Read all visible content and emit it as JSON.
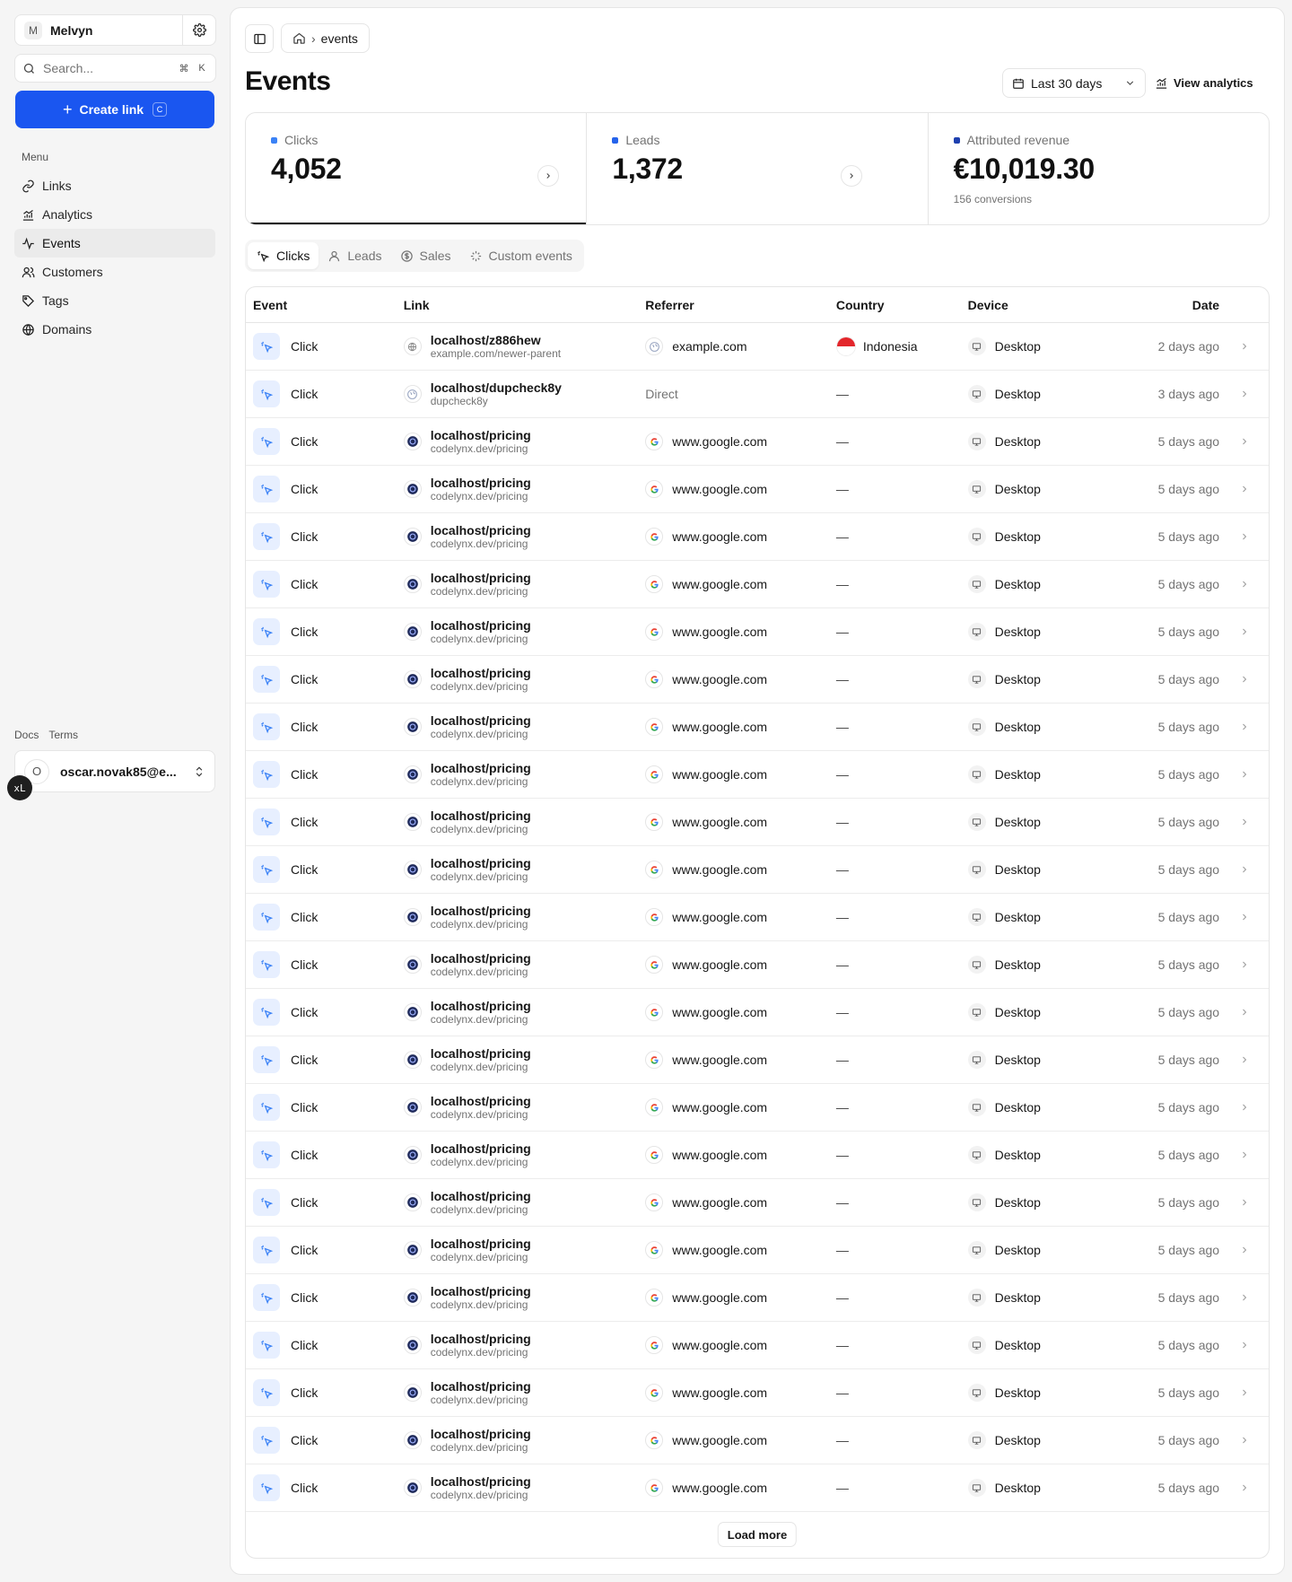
{
  "workspace": {
    "initial": "M",
    "name": "Melvyn"
  },
  "search": {
    "placeholder": "Search...",
    "shortcut_mod": "⌘",
    "shortcut_key": "K"
  },
  "create": {
    "label": "Create link",
    "shortcut": "C"
  },
  "menu": {
    "title": "Menu",
    "items": [
      {
        "label": "Links",
        "icon": "link-icon"
      },
      {
        "label": "Analytics",
        "icon": "chart-icon"
      },
      {
        "label": "Events",
        "icon": "activity-icon",
        "active": true
      },
      {
        "label": "Customers",
        "icon": "users-icon"
      },
      {
        "label": "Tags",
        "icon": "tag-icon"
      },
      {
        "label": "Domains",
        "icon": "globe-icon"
      }
    ]
  },
  "footer": {
    "docs": "Docs",
    "terms": "Terms"
  },
  "user": {
    "initial": "O",
    "email": "oscar.novak85@e...",
    "badge": "xL"
  },
  "breadcrumb": {
    "current": "events"
  },
  "page": {
    "title": "Events"
  },
  "date_range": {
    "label": "Last 30 days"
  },
  "view_analytics": {
    "label": "View analytics"
  },
  "stats": [
    {
      "label": "Clicks",
      "value": "4,052",
      "color": "#3b82f6"
    },
    {
      "label": "Leads",
      "value": "1,372",
      "color": "#2563eb"
    },
    {
      "label": "Attributed revenue",
      "value": "€10,019.30",
      "sub": "156 conversions",
      "color": "#1e40af"
    }
  ],
  "tabs": [
    {
      "label": "Clicks",
      "icon": "cursor-click-icon"
    },
    {
      "label": "Leads",
      "icon": "user-icon"
    },
    {
      "label": "Sales",
      "icon": "dollar-icon"
    },
    {
      "label": "Custom events",
      "icon": "sparkle-icon"
    }
  ],
  "table": {
    "headers": {
      "event": "Event",
      "link": "Link",
      "referrer": "Referrer",
      "country": "Country",
      "device": "Device",
      "date": "Date"
    },
    "rows": [
      {
        "event": "Click",
        "link": "localhost/z886hew",
        "dest": "example.com/newer-parent",
        "referrer": "example.com",
        "country": "Indonesia",
        "device": "Desktop",
        "date": "2 days ago"
      },
      {
        "event": "Click",
        "link": "localhost/dupcheck8y",
        "dest": "dupcheck8y",
        "referrer": "Direct",
        "country": "—",
        "device": "Desktop",
        "date": "3 days ago"
      },
      {
        "event": "Click",
        "link": "localhost/pricing",
        "dest": "codelynx.dev/pricing",
        "referrer": "www.google.com",
        "country": "—",
        "device": "Desktop",
        "date": "5 days ago"
      },
      {
        "event": "Click",
        "link": "localhost/pricing",
        "dest": "codelynx.dev/pricing",
        "referrer": "www.google.com",
        "country": "—",
        "device": "Desktop",
        "date": "5 days ago"
      },
      {
        "event": "Click",
        "link": "localhost/pricing",
        "dest": "codelynx.dev/pricing",
        "referrer": "www.google.com",
        "country": "—",
        "device": "Desktop",
        "date": "5 days ago"
      },
      {
        "event": "Click",
        "link": "localhost/pricing",
        "dest": "codelynx.dev/pricing",
        "referrer": "www.google.com",
        "country": "—",
        "device": "Desktop",
        "date": "5 days ago"
      },
      {
        "event": "Click",
        "link": "localhost/pricing",
        "dest": "codelynx.dev/pricing",
        "referrer": "www.google.com",
        "country": "—",
        "device": "Desktop",
        "date": "5 days ago"
      },
      {
        "event": "Click",
        "link": "localhost/pricing",
        "dest": "codelynx.dev/pricing",
        "referrer": "www.google.com",
        "country": "—",
        "device": "Desktop",
        "date": "5 days ago"
      },
      {
        "event": "Click",
        "link": "localhost/pricing",
        "dest": "codelynx.dev/pricing",
        "referrer": "www.google.com",
        "country": "—",
        "device": "Desktop",
        "date": "5 days ago"
      },
      {
        "event": "Click",
        "link": "localhost/pricing",
        "dest": "codelynx.dev/pricing",
        "referrer": "www.google.com",
        "country": "—",
        "device": "Desktop",
        "date": "5 days ago"
      },
      {
        "event": "Click",
        "link": "localhost/pricing",
        "dest": "codelynx.dev/pricing",
        "referrer": "www.google.com",
        "country": "—",
        "device": "Desktop",
        "date": "5 days ago"
      },
      {
        "event": "Click",
        "link": "localhost/pricing",
        "dest": "codelynx.dev/pricing",
        "referrer": "www.google.com",
        "country": "—",
        "device": "Desktop",
        "date": "5 days ago"
      },
      {
        "event": "Click",
        "link": "localhost/pricing",
        "dest": "codelynx.dev/pricing",
        "referrer": "www.google.com",
        "country": "—",
        "device": "Desktop",
        "date": "5 days ago"
      },
      {
        "event": "Click",
        "link": "localhost/pricing",
        "dest": "codelynx.dev/pricing",
        "referrer": "www.google.com",
        "country": "—",
        "device": "Desktop",
        "date": "5 days ago"
      },
      {
        "event": "Click",
        "link": "localhost/pricing",
        "dest": "codelynx.dev/pricing",
        "referrer": "www.google.com",
        "country": "—",
        "device": "Desktop",
        "date": "5 days ago"
      },
      {
        "event": "Click",
        "link": "localhost/pricing",
        "dest": "codelynx.dev/pricing",
        "referrer": "www.google.com",
        "country": "—",
        "device": "Desktop",
        "date": "5 days ago"
      },
      {
        "event": "Click",
        "link": "localhost/pricing",
        "dest": "codelynx.dev/pricing",
        "referrer": "www.google.com",
        "country": "—",
        "device": "Desktop",
        "date": "5 days ago"
      },
      {
        "event": "Click",
        "link": "localhost/pricing",
        "dest": "codelynx.dev/pricing",
        "referrer": "www.google.com",
        "country": "—",
        "device": "Desktop",
        "date": "5 days ago"
      },
      {
        "event": "Click",
        "link": "localhost/pricing",
        "dest": "codelynx.dev/pricing",
        "referrer": "www.google.com",
        "country": "—",
        "device": "Desktop",
        "date": "5 days ago"
      },
      {
        "event": "Click",
        "link": "localhost/pricing",
        "dest": "codelynx.dev/pricing",
        "referrer": "www.google.com",
        "country": "—",
        "device": "Desktop",
        "date": "5 days ago"
      },
      {
        "event": "Click",
        "link": "localhost/pricing",
        "dest": "codelynx.dev/pricing",
        "referrer": "www.google.com",
        "country": "—",
        "device": "Desktop",
        "date": "5 days ago"
      },
      {
        "event": "Click",
        "link": "localhost/pricing",
        "dest": "codelynx.dev/pricing",
        "referrer": "www.google.com",
        "country": "—",
        "device": "Desktop",
        "date": "5 days ago"
      },
      {
        "event": "Click",
        "link": "localhost/pricing",
        "dest": "codelynx.dev/pricing",
        "referrer": "www.google.com",
        "country": "—",
        "device": "Desktop",
        "date": "5 days ago"
      },
      {
        "event": "Click",
        "link": "localhost/pricing",
        "dest": "codelynx.dev/pricing",
        "referrer": "www.google.com",
        "country": "—",
        "device": "Desktop",
        "date": "5 days ago"
      },
      {
        "event": "Click",
        "link": "localhost/pricing",
        "dest": "codelynx.dev/pricing",
        "referrer": "www.google.com",
        "country": "—",
        "device": "Desktop",
        "date": "5 days ago"
      }
    ]
  },
  "load_more": {
    "label": "Load more"
  }
}
